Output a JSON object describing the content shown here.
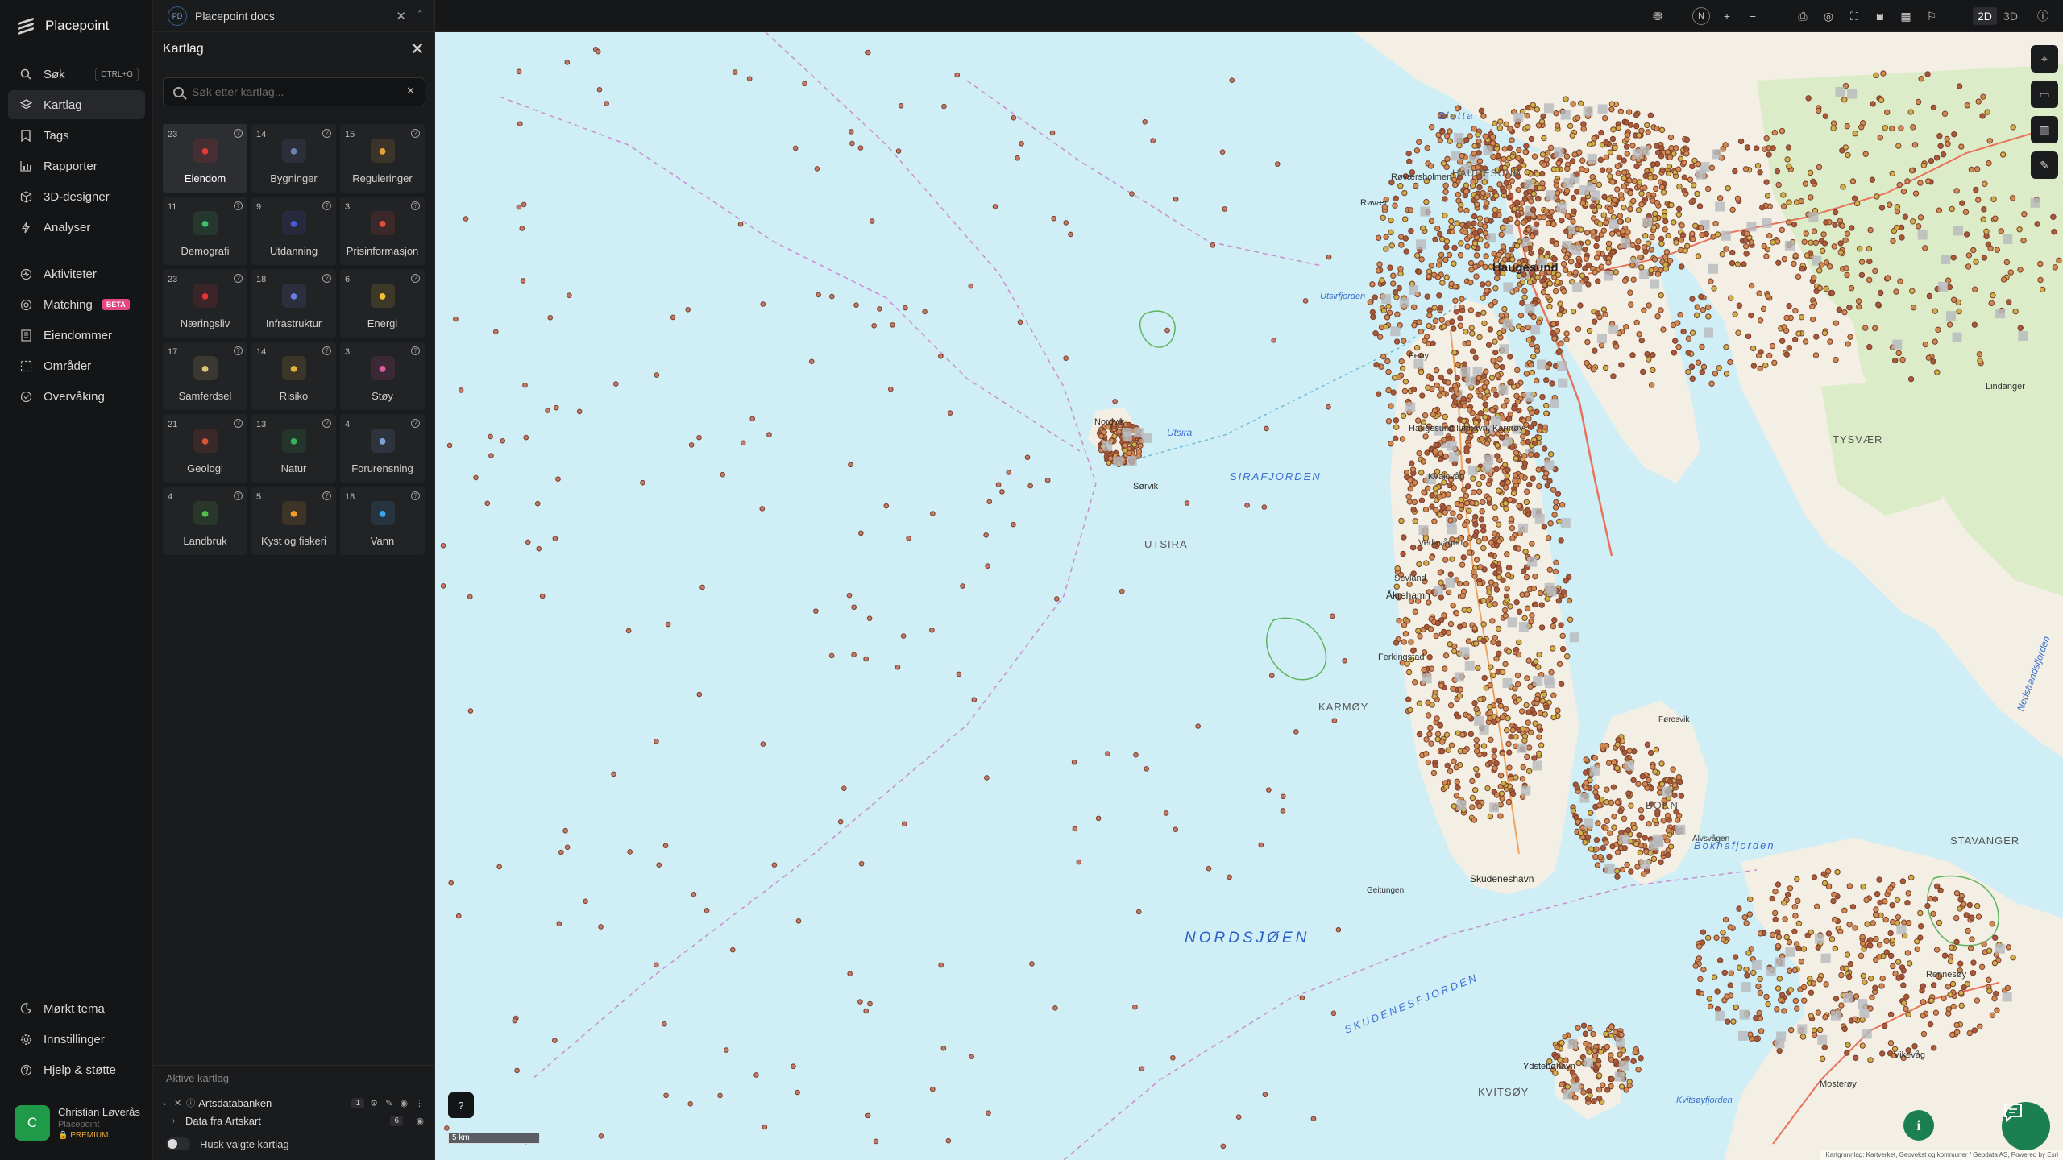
{
  "brand": {
    "name": "Placepoint"
  },
  "nav": {
    "items": [
      {
        "label": "Søk",
        "icon": "search-icon",
        "shortcut": "CTRL+G"
      },
      {
        "label": "Kartlag",
        "icon": "layers-icon",
        "active": true
      },
      {
        "label": "Tags",
        "icon": "bookmark-icon"
      },
      {
        "label": "Rapporter",
        "icon": "chart-icon"
      },
      {
        "label": "3D-designer",
        "icon": "cube-icon"
      },
      {
        "label": "Analyser",
        "icon": "bolt-icon"
      },
      {
        "label": "Aktiviteter",
        "icon": "activity-icon"
      },
      {
        "label": "Matching",
        "icon": "target-icon",
        "badge": "BETA"
      },
      {
        "label": "Eiendommer",
        "icon": "building-icon"
      },
      {
        "label": "Områder",
        "icon": "area-icon"
      },
      {
        "label": "Overvåking",
        "icon": "monitor-icon"
      }
    ],
    "bottom": [
      {
        "label": "Mørkt tema",
        "icon": "moon-icon"
      },
      {
        "label": "Innstillinger",
        "icon": "gear-icon"
      },
      {
        "label": "Hjelp & støtte",
        "icon": "help-icon"
      }
    ]
  },
  "user": {
    "initial": "C",
    "name": "Christian Løverås",
    "org": "Placepoint",
    "tier": "PREMIUM"
  },
  "doc": {
    "badge": "PD",
    "title": "Placepoint docs"
  },
  "panel": {
    "title": "Kartlag",
    "search_placeholder": "Søk etter kartlag...",
    "tiles": [
      {
        "count": "23",
        "label": "Eiendom",
        "icon": "pin-icon",
        "color": "#e23b3b",
        "selected": true
      },
      {
        "count": "14",
        "label": "Bygninger",
        "icon": "building-icon",
        "color": "#6d82b8"
      },
      {
        "count": "15",
        "label": "Reguleringer",
        "icon": "signpost-icon",
        "color": "#e3a23a"
      },
      {
        "count": "11",
        "label": "Demografi",
        "icon": "people-icon",
        "color": "#3fbf6a"
      },
      {
        "count": "9",
        "label": "Utdanning",
        "icon": "graduation-icon",
        "color": "#4b5bd6"
      },
      {
        "count": "3",
        "label": "Prisinformasjon",
        "icon": "pricetag-icon",
        "color": "#e34b3b"
      },
      {
        "count": "23",
        "label": "Næringsliv",
        "icon": "shopping-bag-icon",
        "color": "#e3343b"
      },
      {
        "count": "18",
        "label": "Infrastruktur",
        "icon": "globe-icon",
        "color": "#6b7de0"
      },
      {
        "count": "6",
        "label": "Energi",
        "icon": "lightning-icon",
        "color": "#f2c233"
      },
      {
        "count": "17",
        "label": "Samferdsel",
        "icon": "bus-icon",
        "color": "#d8c27a"
      },
      {
        "count": "14",
        "label": "Risiko",
        "icon": "hazard-icon",
        "color": "#e0b13a"
      },
      {
        "count": "3",
        "label": "Støy",
        "icon": "noise-gauge-icon",
        "color": "#e05aa0"
      },
      {
        "count": "21",
        "label": "Geologi",
        "icon": "terrain-icon",
        "color": "#d6553a"
      },
      {
        "count": "13",
        "label": "Natur",
        "icon": "leaf-icon",
        "color": "#36b35a"
      },
      {
        "count": "4",
        "label": "Forurensning",
        "icon": "factory-icon",
        "color": "#7ea3d6"
      },
      {
        "count": "4",
        "label": "Landbruk",
        "icon": "sprout-icon",
        "color": "#4fbf4a"
      },
      {
        "count": "5",
        "label": "Kyst og fiskeri",
        "icon": "fish-icon",
        "color": "#f09a2a"
      },
      {
        "count": "18",
        "label": "Vann",
        "icon": "water-drop-icon",
        "color": "#3aa8e8"
      }
    ],
    "active_title": "Aktive kartlag",
    "active_layers": [
      {
        "label": "Artsdatabanken",
        "count": "1"
      },
      {
        "label": "Data fra Artskart",
        "count": "6"
      }
    ],
    "remember_label": "Husk valgte kartlag"
  },
  "toolbar": {
    "compass": "N",
    "zoom_in": "+",
    "zoom_out": "−",
    "mode_2d": "2D",
    "mode_3d": "3D",
    "active_mode": "2D"
  },
  "map": {
    "labels": [
      {
        "text": "Sletta",
        "style": "water-it"
      },
      {
        "text": "HAUGESUND",
        "style": "area"
      },
      {
        "text": "Haugesund",
        "style": "city"
      },
      {
        "text": "Utsirfjorden",
        "style": "water-sm"
      },
      {
        "text": "Røvær",
        "style": "small"
      },
      {
        "text": "Røværsholmen",
        "style": "small"
      },
      {
        "text": "Feøy",
        "style": "small"
      },
      {
        "text": "Haugesund lufthavn, Karmøy",
        "style": "small"
      },
      {
        "text": "Kvalavåg",
        "style": "small"
      },
      {
        "text": "Vedavågen",
        "style": "small"
      },
      {
        "text": "Sevland",
        "style": "small"
      },
      {
        "text": "Åkrehamn",
        "style": "small"
      },
      {
        "text": "Ferkingstad",
        "style": "small"
      },
      {
        "text": "Nordvik",
        "style": "small"
      },
      {
        "text": "Utsira",
        "style": "small"
      },
      {
        "text": "Sørvik",
        "style": "small"
      },
      {
        "text": "SIRAFJORDEN",
        "style": "water-caps"
      },
      {
        "text": "UTSIRA",
        "style": "area"
      },
      {
        "text": "KARMØY",
        "style": "area"
      },
      {
        "text": "Skudeneshavn",
        "style": "small"
      },
      {
        "text": "Geitungen",
        "style": "small"
      },
      {
        "text": "NORDSJØEN",
        "style": "sea"
      },
      {
        "text": "SKUDENESFJORDEN",
        "style": "water-caps"
      },
      {
        "text": "BOKN",
        "style": "area"
      },
      {
        "text": "Boknafjorden",
        "style": "water-it"
      },
      {
        "text": "STAVANGER",
        "style": "area"
      },
      {
        "text": "TYSVÆR",
        "style": "area"
      },
      {
        "text": "KVITSØY",
        "style": "area"
      },
      {
        "text": "Ydstebøhavn",
        "style": "small"
      },
      {
        "text": "Kvitsøyfjorden",
        "style": "water-sm"
      },
      {
        "text": "Rennesøy",
        "style": "small"
      },
      {
        "text": "Vikevåg",
        "style": "small"
      },
      {
        "text": "Mosterøy",
        "style": "small"
      },
      {
        "text": "Lindanger",
        "style": "small"
      },
      {
        "text": "Føresvik",
        "style": "small"
      },
      {
        "text": "Alvsvågen",
        "style": "small"
      },
      {
        "text": "Nedstrandsfjorden",
        "style": "water-it"
      }
    ],
    "scale_label": "5 km",
    "attribution": "Kartgrunnlag: Kartverket, Geovekst og kommuner / Geodata AS, Powered by Esri"
  },
  "colors": {
    "sea": "#cfeef6",
    "land": "#f4f1e8",
    "forest": "#dcebc6",
    "accent": "#1c7f52",
    "beta": "#e54780"
  }
}
